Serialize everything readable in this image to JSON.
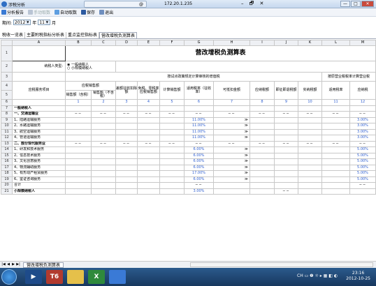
{
  "window": {
    "title": "涉税分析",
    "tab_glyph": "@",
    "address": "172.20.1.235",
    "restore": "– 🗗 ✕",
    "btn_min": "—",
    "btn_max": "□",
    "btn_close": "✕"
  },
  "toolbar": {
    "analysis_report": "分析报告",
    "manual_fetch": "手动取数",
    "auto_fetch": "自动取数",
    "save": "保存",
    "exit": "退出"
  },
  "period": {
    "label": "期间:",
    "year": "2012",
    "year_unit": "年",
    "month": "11",
    "month_unit": "月"
  },
  "tabs": [
    "税收一览表",
    "主要附税指标分析表",
    "重点监控指标表",
    "营改增税负测算表"
  ],
  "columns": [
    "A",
    "B",
    "C",
    "D",
    "E",
    "F",
    "G",
    "H",
    "I",
    "J",
    "K",
    "L",
    "M"
  ],
  "sheet": {
    "title": "营改增税负测算表",
    "taxpayer_label": "纳税人类型:",
    "opt_general": "一般纳税人",
    "opt_small": "小规模纳税人",
    "calc_header": "按试点政策规定计算审核的增值税",
    "bus_header": "按原营业税税率计算营业税",
    "service_item": "应税服务项目",
    "sales_header": "应税销售额",
    "sales_ex": "销售额（含税）",
    "sales_in": "销售额（不含税）",
    "deduct": "差额征收扣除额",
    "exempt": "免税、零税率应税销售额",
    "calc_tax": "计算销售额",
    "rate": "适用税率（征收率）",
    "deductible": "可抵扣金额",
    "payable": "应纳税额",
    "preferential": "即征即退税额",
    "actual": "实纳税额",
    "bus_rate": "适用税率",
    "bus_tax": "应纳税",
    "col_nums": [
      "1",
      "2",
      "3",
      "4",
      "5",
      "6",
      "7",
      "8",
      "9",
      "10",
      "11",
      "12"
    ],
    "dash": "−−",
    "chev": "≫"
  },
  "rows": [
    {
      "n": "7",
      "label": "一般纳税人",
      "bold": true,
      "rate": "",
      "bus": ""
    },
    {
      "n": "8",
      "label": "一、交通运输业",
      "bold": true,
      "rate": "−−",
      "bus": "−−"
    },
    {
      "n": "9",
      "label": "1、陆路运输服务",
      "rate": "11.00%",
      "bus": "3.00%"
    },
    {
      "n": "10",
      "label": "2、水路运输服务",
      "rate": "11.00%",
      "bus": "3.00%"
    },
    {
      "n": "11",
      "label": "3、航空运输服务",
      "rate": "11.00%",
      "bus": "3.00%"
    },
    {
      "n": "12",
      "label": "4、管道运输服务",
      "rate": "11.00%",
      "bus": "3.00%"
    },
    {
      "n": "13",
      "label": "二、部分现代服务业",
      "bold": true,
      "rate": "−−",
      "bus": "−−"
    },
    {
      "n": "14",
      "label": "1、研发和技术服务",
      "rate": "6.00%",
      "bus": "5.00%"
    },
    {
      "n": "15",
      "label": "2、信息技术服务",
      "rate": "6.00%",
      "bus": "5.00%"
    },
    {
      "n": "16",
      "label": "3、文化创意服务",
      "rate": "6.00%",
      "bus": "5.00%"
    },
    {
      "n": "17",
      "label": "4、物流辅助服务",
      "rate": "6.00%",
      "bus": "5.00%"
    },
    {
      "n": "18",
      "label": "5、有形动产租赁服务",
      "rate": "17.00%",
      "bus": "5.00%"
    },
    {
      "n": "19",
      "label": "6、鉴证咨询服务",
      "rate": "6.00%",
      "bus": "5.00%"
    },
    {
      "n": "20",
      "label": "合计",
      "rate": "−−",
      "bus": "−−"
    },
    {
      "n": "21",
      "label": "小规模纳税人",
      "bold": true,
      "rate": "3.00%",
      "bus": ""
    }
  ],
  "sheet_tab": "营改增税负测算表",
  "taskbar": {
    "t6": "T6",
    "tray": "CH ▭ ❷ ☼ ▸ ▦ ◧ ◐",
    "time": "23:16",
    "date": "2012-10-25"
  }
}
